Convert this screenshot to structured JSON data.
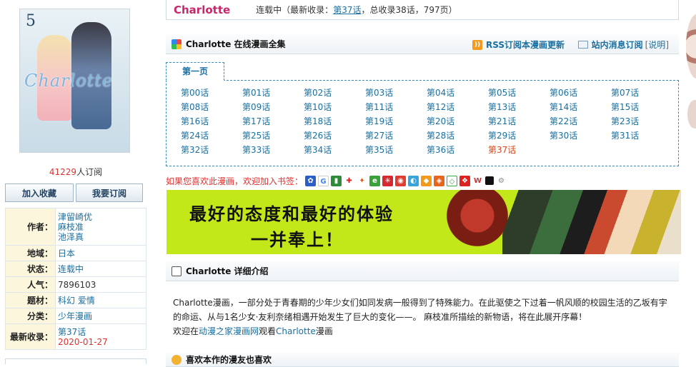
{
  "left": {
    "subscribers_count": "41229",
    "subscribers_suffix": "人订阅",
    "buttons": {
      "favorite": "加入收藏",
      "subscribe": "我要订阅"
    },
    "cover_volume": "5",
    "cover_logo": "Charlotte",
    "info": {
      "author_label": "作者：",
      "authors": [
        "津留崎优",
        "麻枝准",
        "池泽真"
      ],
      "region_label": "地域：",
      "region": "日本",
      "status_label": "状态：",
      "status": "连载中",
      "popularity_label": "人气：",
      "popularity": "7896103",
      "genre_label": "题材：",
      "genre": "科幻 爱情",
      "category_label": "分类：",
      "category": "少年漫画",
      "latest_label": "最新收录：",
      "latest": "第37话",
      "latest_date": "2020-01-27"
    }
  },
  "topbar": {
    "title": "Charlotte",
    "status_prefix": "连载中（最新收录：",
    "latest_link": "第37话",
    "status_suffix": "，总收录38话，797页）"
  },
  "chapters_section": {
    "title": "Charlotte 在线漫画全集",
    "rss_label": "RSS订阅本漫画更新",
    "mail_label": "站内消息订阅",
    "mail_extra_open": "[",
    "mail_extra_link": "说明",
    "mail_extra_close": "]",
    "tab": "第一页",
    "chapters": [
      "第00话",
      "第01话",
      "第02话",
      "第03话",
      "第04话",
      "第05话",
      "第06话",
      "第07话",
      "第08话",
      "第09话",
      "第10话",
      "第11话",
      "第12话",
      "第13话",
      "第14话",
      "第15话",
      "第16话",
      "第17话",
      "第18话",
      "第19话",
      "第20话",
      "第21话",
      "第22话",
      "第23话",
      "第24话",
      "第25话",
      "第26话",
      "第27话",
      "第28话",
      "第29话",
      "第30话",
      "第31话",
      "第32话",
      "第33话",
      "第34话",
      "第35话",
      "第36话",
      "第37话"
    ]
  },
  "bookmark": {
    "text": "如果您喜欢此漫画，欢迎加入书签："
  },
  "banner": {
    "line1": "最好的态度和最好的体验",
    "line2": "一并奉上！"
  },
  "details": {
    "title": "Charlotte 详细介绍",
    "desc_name": "Charlotte",
    "desc_p1": "漫画，一部分处于青春期的少年少女们如同发病一般得到了特殊能力。在此驱使之下过着一帆风顺的校园生活的乙坂有宇的命运、从与1名少女·友利奈绪相遇开始发生了巨大的变化——。 麻枝准所描绘的新物语，将在此展开序幕！",
    "desc_p2_prefix": "欢迎在",
    "desc_p2_site": "动漫之家漫画网",
    "desc_p2_mid": "观看",
    "desc_p2_name": "Charlotte",
    "desc_p2_suffix": "漫画"
  },
  "bottom_section": {
    "title": "喜欢本作的漫友也喜欢"
  }
}
